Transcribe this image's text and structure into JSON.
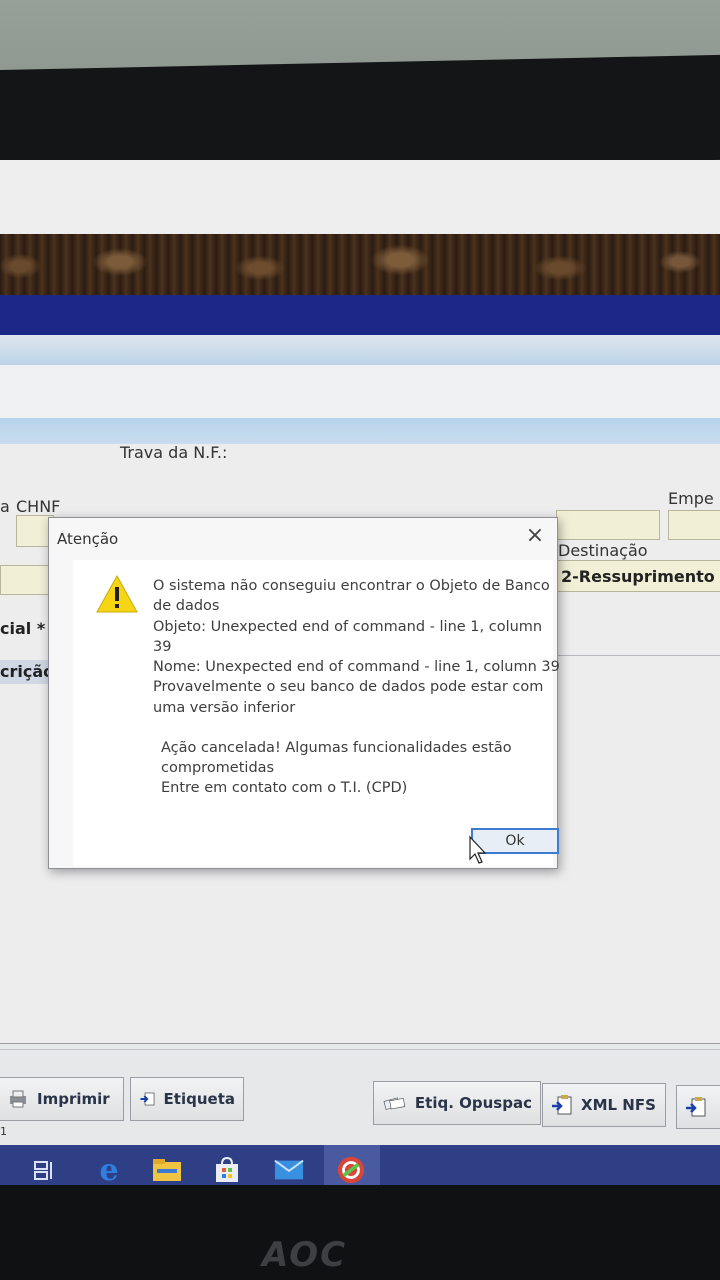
{
  "dialog": {
    "title": "Atenção",
    "close_glyph": "×",
    "lines": [
      "O sistema não conseguiu encontrar o Objeto de Banco",
      "de dados",
      "Objeto: Unexpected end of command - line 1, column",
      "39",
      "Nome: Unexpected end of command - line 1, column 39",
      "Provavelmente o seu banco de dados pode estar com",
      "uma versão inferior"
    ],
    "lines2": [
      "Ação cancelada! Algumas funcionalidades estão",
      "comprometidas",
      "Entre em contato com o T.I. (CPD)"
    ],
    "ok_label": "Ok",
    "icon": "warning-icon"
  },
  "form": {
    "trava_label": "Trava da N.F.:",
    "chnf_label": "CHNF",
    "chnf_prefix": "a",
    "empe_label": "Empe",
    "destinacao_label": "Destinação",
    "destinacao_value": "2-Ressuprimento",
    "cial_label": "cial *",
    "cricao_label": "crição N"
  },
  "toolbar": {
    "imprimir": "Imprimir",
    "etiqueta": "Etiqueta",
    "etiq_opuspac": "Etiq. Opuspac",
    "xml_nfs": "XML NFS"
  },
  "status": {
    "left_text": "1"
  },
  "monitor": {
    "brand": "AOC"
  },
  "colors": {
    "navy": "#1c2788",
    "field_bg": "#f1efd5",
    "taskbar": "#2f3f86",
    "warning": "#f5d514"
  },
  "taskbar": {
    "icons": [
      "task-view-icon",
      "edge-icon",
      "file-explorer-icon",
      "store-icon",
      "mail-icon",
      "app-icon"
    ]
  }
}
